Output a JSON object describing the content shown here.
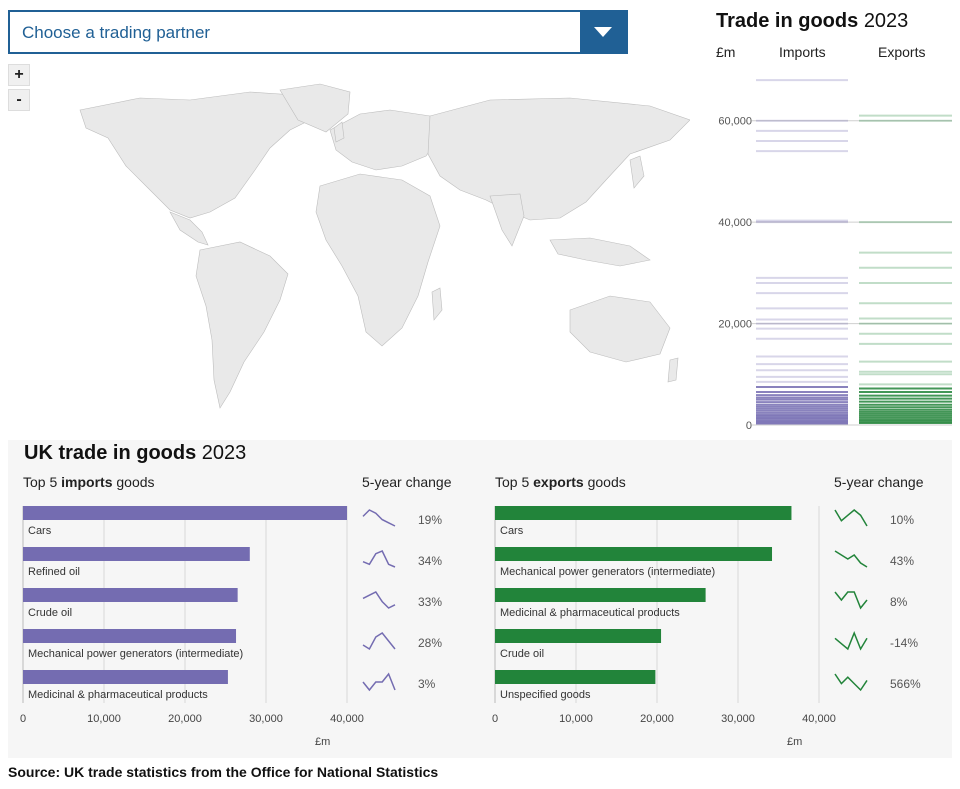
{
  "dropdown": {
    "placeholder": "Choose a trading partner"
  },
  "zoom": {
    "in_label": "+",
    "out_label": "-"
  },
  "side": {
    "title_bold": "Trade in goods",
    "title_year": "2023",
    "unit": "£m",
    "col_imports": "Imports",
    "col_exports": "Exports",
    "y_ticks": [
      "0",
      "20,000",
      "40,000",
      "60,000"
    ]
  },
  "panel": {
    "title_bold": "UK trade in goods",
    "title_year": "2023",
    "imports_head_pre": "Top 5 ",
    "imports_head_bold": "imports",
    "imports_head_post": " goods",
    "exports_head_pre": "Top 5 ",
    "exports_head_bold": "exports",
    "exports_head_post": " goods",
    "change_head": "5-year change",
    "x_unit": "£m",
    "x_ticks": [
      "0",
      "10,000",
      "20,000",
      "30,000",
      "40,000"
    ]
  },
  "colors": {
    "imports": "#746cb1",
    "exports": "#22843a",
    "accent": "#206095"
  },
  "chart_data": [
    {
      "type": "bar",
      "title": "Top 5 imports goods",
      "xlabel": "£m",
      "xlim": [
        0,
        40000
      ],
      "categories": [
        "Cars",
        "Refined oil",
        "Crude oil",
        "Mechanical power generators (intermediate)",
        "Medicinal & pharmaceutical products"
      ],
      "values": [
        40000,
        28000,
        26500,
        26300,
        25300
      ],
      "change": [
        "19%",
        "34%",
        "33%",
        "28%",
        "3%"
      ],
      "sparklines": [
        [
          4,
          6,
          5,
          3,
          2,
          1
        ],
        [
          3,
          2,
          6,
          7,
          2,
          1
        ],
        [
          4,
          5,
          6,
          3,
          1,
          2
        ],
        [
          3,
          2,
          5,
          6,
          4,
          2
        ],
        [
          4,
          3,
          4,
          4,
          5,
          3
        ]
      ]
    },
    {
      "type": "bar",
      "title": "Top 5 exports goods",
      "xlabel": "£m",
      "xlim": [
        0,
        40000
      ],
      "categories": [
        "Cars",
        "Mechanical power generators (intermediate)",
        "Medicinal & pharmaceutical products",
        "Crude oil",
        "Unspecified goods"
      ],
      "values": [
        36600,
        34200,
        26000,
        20500,
        19800
      ],
      "change": [
        "10%",
        "43%",
        "8%",
        "-14%",
        "566%"
      ],
      "sparklines": [
        [
          4,
          2,
          3,
          4,
          3,
          1
        ],
        [
          5,
          4,
          3,
          4,
          2,
          1
        ],
        [
          4,
          3,
          4,
          4,
          2,
          3
        ],
        [
          4,
          3,
          2,
          5,
          2,
          4
        ],
        [
          6,
          3,
          5,
          3,
          1,
          4
        ]
      ]
    },
    {
      "type": "bar",
      "title": "Trade in goods 2023",
      "ylabel": "£m",
      "ylim": [
        0,
        70000
      ],
      "series": [
        {
          "name": "Imports",
          "values": [
            68000,
            60000,
            58000,
            56000,
            54000,
            40300,
            40000,
            29000,
            28000,
            26000,
            23000,
            20800,
            20000,
            19000,
            17000,
            13500,
            12000,
            10800,
            9500,
            8500,
            7500,
            6500,
            5900,
            5400,
            5000,
            4500,
            4000,
            3600,
            3200,
            2800,
            2400,
            2000,
            1700,
            1400,
            1100,
            800,
            500,
            300
          ]
        },
        {
          "name": "Exports",
          "values": [
            61000,
            60000,
            40000,
            34000,
            31000,
            28000,
            24000,
            21000,
            20000,
            18000,
            16000,
            12500,
            10500,
            10000,
            8000,
            7200,
            6500,
            5800,
            5200,
            4600,
            4000,
            3500,
            3000,
            2600,
            2200,
            1800,
            1400,
            1000,
            700,
            400
          ]
        }
      ]
    }
  ]
}
